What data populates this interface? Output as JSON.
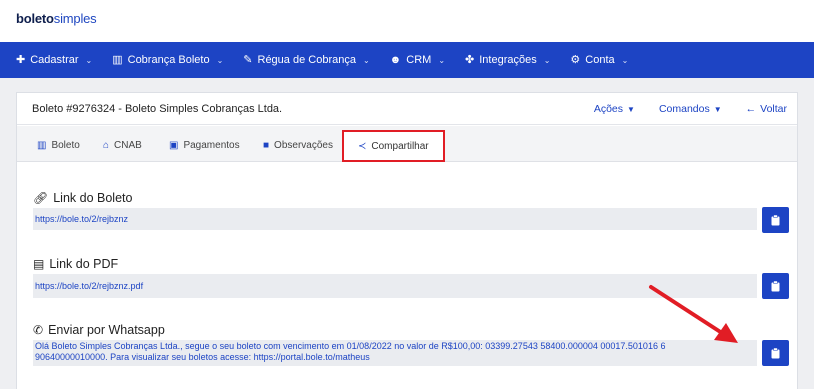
{
  "brand": {
    "part1": "boleto",
    "part2": "simples"
  },
  "nav": [
    {
      "label": "Cadastrar",
      "icon": "plus-icon"
    },
    {
      "label": "Cobrança Boleto",
      "icon": "barcode-icon"
    },
    {
      "label": "Régua de Cobrança",
      "icon": "bullhorn-icon"
    },
    {
      "label": "CRM",
      "icon": "users-icon"
    },
    {
      "label": "Integrações",
      "icon": "puzzle-icon"
    },
    {
      "label": "Conta",
      "icon": "gears-icon"
    }
  ],
  "card": {
    "title": "Boleto #9276324 - Boleto Simples Cobranças Ltda.",
    "actions_label": "Ações",
    "commands_label": "Comandos",
    "back_label": "Voltar"
  },
  "tabs": [
    {
      "label": "Boleto",
      "icon": "barcode-icon"
    },
    {
      "label": "CNAB",
      "icon": "bank-icon"
    },
    {
      "label": "Pagamentos",
      "icon": "money-icon"
    },
    {
      "label": "Observações",
      "icon": "note-icon"
    },
    {
      "label": "Compartilhar",
      "icon": "share-icon",
      "active": true
    }
  ],
  "sections": {
    "link_boleto": {
      "title": "Link do Boleto",
      "icon": "link-icon",
      "value": "https://bole.to/2/rejbznz"
    },
    "link_pdf": {
      "title": "Link do PDF",
      "icon": "pdf-icon",
      "value": "https://bole.to/2/rejbznz.pdf"
    },
    "whatsapp": {
      "title": "Enviar por Whatsapp",
      "icon": "whatsapp-icon",
      "line1": "Olá Boleto Simples Cobranças Ltda., segue o seu boleto com vencimento em 01/08/2022 no valor de R$100,00: 03399.27543 58400.000004 00017.501016 6",
      "line2": "90640000010000. Para visualizar seu boletos acesse: https://portal.bole.to/matheus"
    }
  },
  "colors": {
    "primary": "#1d44c4",
    "highlight": "#e11d25",
    "field_bg": "#eaecf0"
  }
}
